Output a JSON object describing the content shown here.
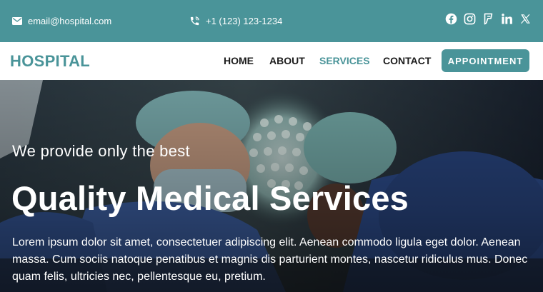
{
  "topbar": {
    "email": "email@hospital.com",
    "phone": "+1 (123) 123-1234",
    "social_icons": [
      "facebook-icon",
      "instagram-icon",
      "foursquare-icon",
      "linkedin-icon",
      "x-icon"
    ],
    "background": "#4a9499"
  },
  "navbar": {
    "logo": "HOSPITAL",
    "items": [
      {
        "label": "HOME",
        "active": false
      },
      {
        "label": "ABOUT",
        "active": false
      },
      {
        "label": "SERVICES",
        "active": true
      },
      {
        "label": "CONTACT",
        "active": false
      }
    ],
    "appointment_label": "APPOINTMENT"
  },
  "hero": {
    "subtitle": "We provide only the best",
    "title": "Quality Medical Services",
    "body": "Lorem ipsum dolor sit amet, consectetuer adipiscing elit. Aenean commodo ligula eget dolor. Aenean massa. Cum sociis natoque penatibus et magnis dis parturient montes, nascetur ridiculus mus. Donec quam felis, ultricies nec, pellentesque eu, pretium."
  },
  "colors": {
    "accent": "#4a9499",
    "text_dark": "#1b1b1b"
  }
}
